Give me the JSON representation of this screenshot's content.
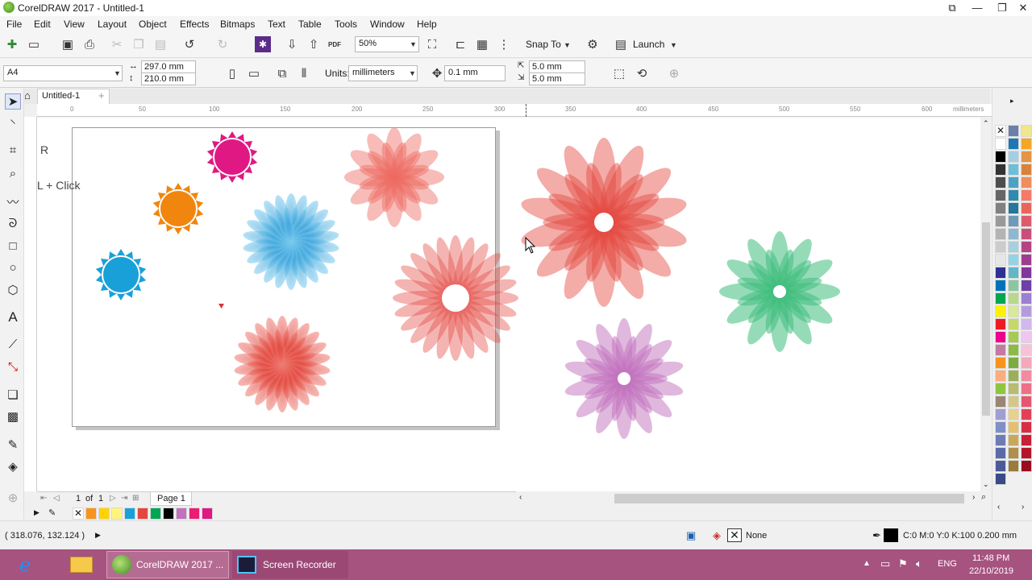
{
  "window": {
    "title": "CorelDRAW 2017 - Untitled-1",
    "controls": [
      "⧉",
      "—",
      "❐",
      "✕"
    ]
  },
  "menu": [
    "File",
    "Edit",
    "View",
    "Layout",
    "Object",
    "Effects",
    "Bitmaps",
    "Text",
    "Table",
    "Tools",
    "Window",
    "Help"
  ],
  "toolbar": {
    "zoom": "50%",
    "snap_to": "Snap To",
    "launch": "Launch"
  },
  "property_bar": {
    "page_size": "A4",
    "width": "297.0 mm",
    "height": "210.0 mm",
    "units_label": "Units:",
    "units": "millimeters",
    "nudge": "0.1 mm",
    "dup_x": "5.0 mm",
    "dup_y": "5.0 mm"
  },
  "document_tab": "Untitled-1",
  "ruler": {
    "h_labels": [
      "0",
      "50",
      "100",
      "150",
      "200",
      "250",
      "300",
      "350",
      "400",
      "450",
      "500",
      "550",
      "600"
    ],
    "h_unit": "millimeters"
  },
  "canvas_notes": {
    "line1": "R",
    "line2": "L + Click"
  },
  "flowers": {
    "pink_sun": "#e01884",
    "orange_sun": "#f0860e",
    "blue_sun": "#1aa0d8",
    "blue_flower": "#4cb6e6",
    "red_flower": "#e4473f",
    "salmon_flower": "#ee6a62",
    "green_flower": "#3fbd7e",
    "purple_flower": "#c171bd"
  },
  "page_nav": {
    "current": "1",
    "of": "of",
    "total": "1",
    "page_tab": "Page 1"
  },
  "status": {
    "coords": "( 318.076, 132.124 )",
    "fill": "None",
    "outline": "C:0 M:0 Y:0 K:100  0.200 mm"
  },
  "taskbar": {
    "app1": "CorelDRAW 2017 ...",
    "app2": "Screen Recorder",
    "lang": "ENG",
    "time": "11:48 PM",
    "date": "22/10/2019"
  }
}
